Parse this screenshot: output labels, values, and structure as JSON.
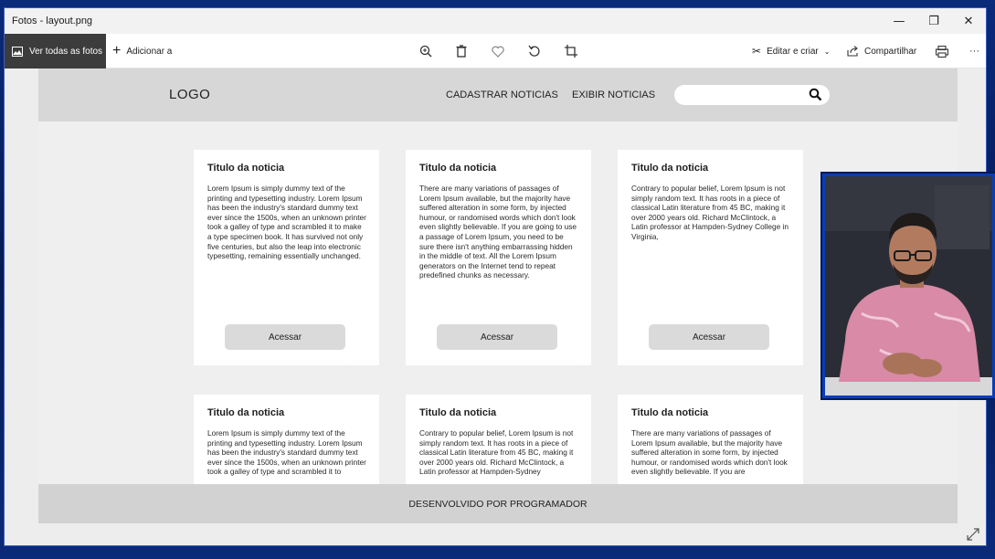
{
  "window": {
    "title": "Fotos - layout.png",
    "controls": {
      "minimize": "—",
      "maximize": "❐",
      "close": "✕"
    }
  },
  "toolbar": {
    "view_all_label": "Ver todas as fotos",
    "add_label": "Adicionar a",
    "edit_create_label": "Editar e criar",
    "share_label": "Compartilhar",
    "more_label": "···",
    "icons": [
      "zoom-icon",
      "delete-icon",
      "favorite-icon",
      "rotate-icon",
      "crop-icon",
      "print-icon"
    ]
  },
  "mockup": {
    "logo": "LOGO",
    "nav": [
      "CADASTRAR NOTICIAS",
      "EXIBIR NOTICIAS"
    ],
    "search_placeholder": "",
    "cards": [
      {
        "title": "Titulo da noticia",
        "body": "Lorem Ipsum is simply dummy text of the printing and typesetting industry. Lorem Ipsum has been the industry's standard dummy text ever since the 1500s, when an unknown printer took a galley of type and scrambled it to make a type specimen book. It has survived not only five centuries, but also the leap into electronic typesetting, remaining essentially unchanged.",
        "button": "Acessar"
      },
      {
        "title": "Titulo da noticia",
        "body": "There are many variations of passages of Lorem Ipsum available, but the majority have suffered alteration in some form, by injected humour, or randomised words which don't look even slightly believable. If you are going to use a passage of Lorem Ipsum, you need to be sure there isn't anything embarrassing hidden in the middle of text. All the Lorem Ipsum generators on the Internet tend to repeat predefined chunks as necessary.",
        "button": "Acessar"
      },
      {
        "title": "Titulo da noticia",
        "body": "Contrary to popular belief, Lorem Ipsum is not simply random text. It has roots in a piece of classical Latin literature from 45 BC, making it over 2000 years old. Richard McClintock, a Latin professor at Hampden-Sydney College in Virginia,",
        "button": "Acessar"
      },
      {
        "title": "Titulo da noticia",
        "body": "Lorem Ipsum is simply dummy text of the printing and typesetting industry. Lorem Ipsum has been the industry's standard dummy text ever since the 1500s, when an unknown printer took a galley of type and scrambled it to"
      },
      {
        "title": "Titulo da noticia",
        "body": "Contrary to popular belief, Lorem Ipsum is not simply random text. It has roots in a piece of classical Latin literature from 45 BC, making it over 2000 years old. Richard McClintock, a Latin professor at Hampden-Sydney"
      },
      {
        "title": "Titulo da noticia",
        "body": "There are many variations of passages of Lorem Ipsum available, but the majority have suffered alteration in some form, by injected humour, or randomised words which don't look even slightly believable. If you are"
      }
    ],
    "footer": "DESENVOLVIDO POR PROGRAMADOR"
  },
  "colors": {
    "frame": "#0a2a7a",
    "webcam_border": "#0b3db8",
    "toolbar_dark": "#3c3c3c",
    "mock_header": "#d7d7d7",
    "button_gray": "#dadada"
  }
}
